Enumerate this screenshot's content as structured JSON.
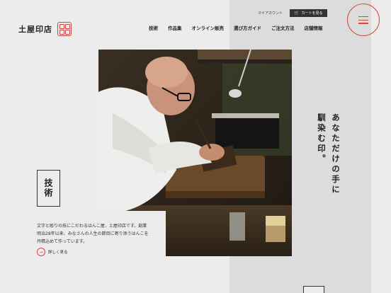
{
  "header": {
    "logo_text": "土屋印店",
    "mypage_label": "マイアカウント",
    "cart_label": "カートを見る",
    "nav": [
      "技術",
      "作品集",
      "オンライン販売",
      "選び方ガイド",
      "ご注文方法",
      "店舗情報"
    ]
  },
  "feature": {
    "category": "技術",
    "description_line1": "文字と彫りの技にこだわるはんこ屋、土屋印店です。創業",
    "description_line2": "明治28年以来、みなさんの人生の節目に寄り添うはんこを",
    "description_line3": "丹精込めて作っています。",
    "more_label": "詳しく見る"
  },
  "tagline": {
    "line1": "あなただけの手に",
    "line2": "馴染む印。"
  },
  "colors": {
    "accent": "#d9453f",
    "background": "#ececec",
    "band": "#dcdcdc"
  },
  "icons": {
    "menu": "hamburger-icon",
    "cart": "cart-icon",
    "more": "arrow-right-icon"
  }
}
